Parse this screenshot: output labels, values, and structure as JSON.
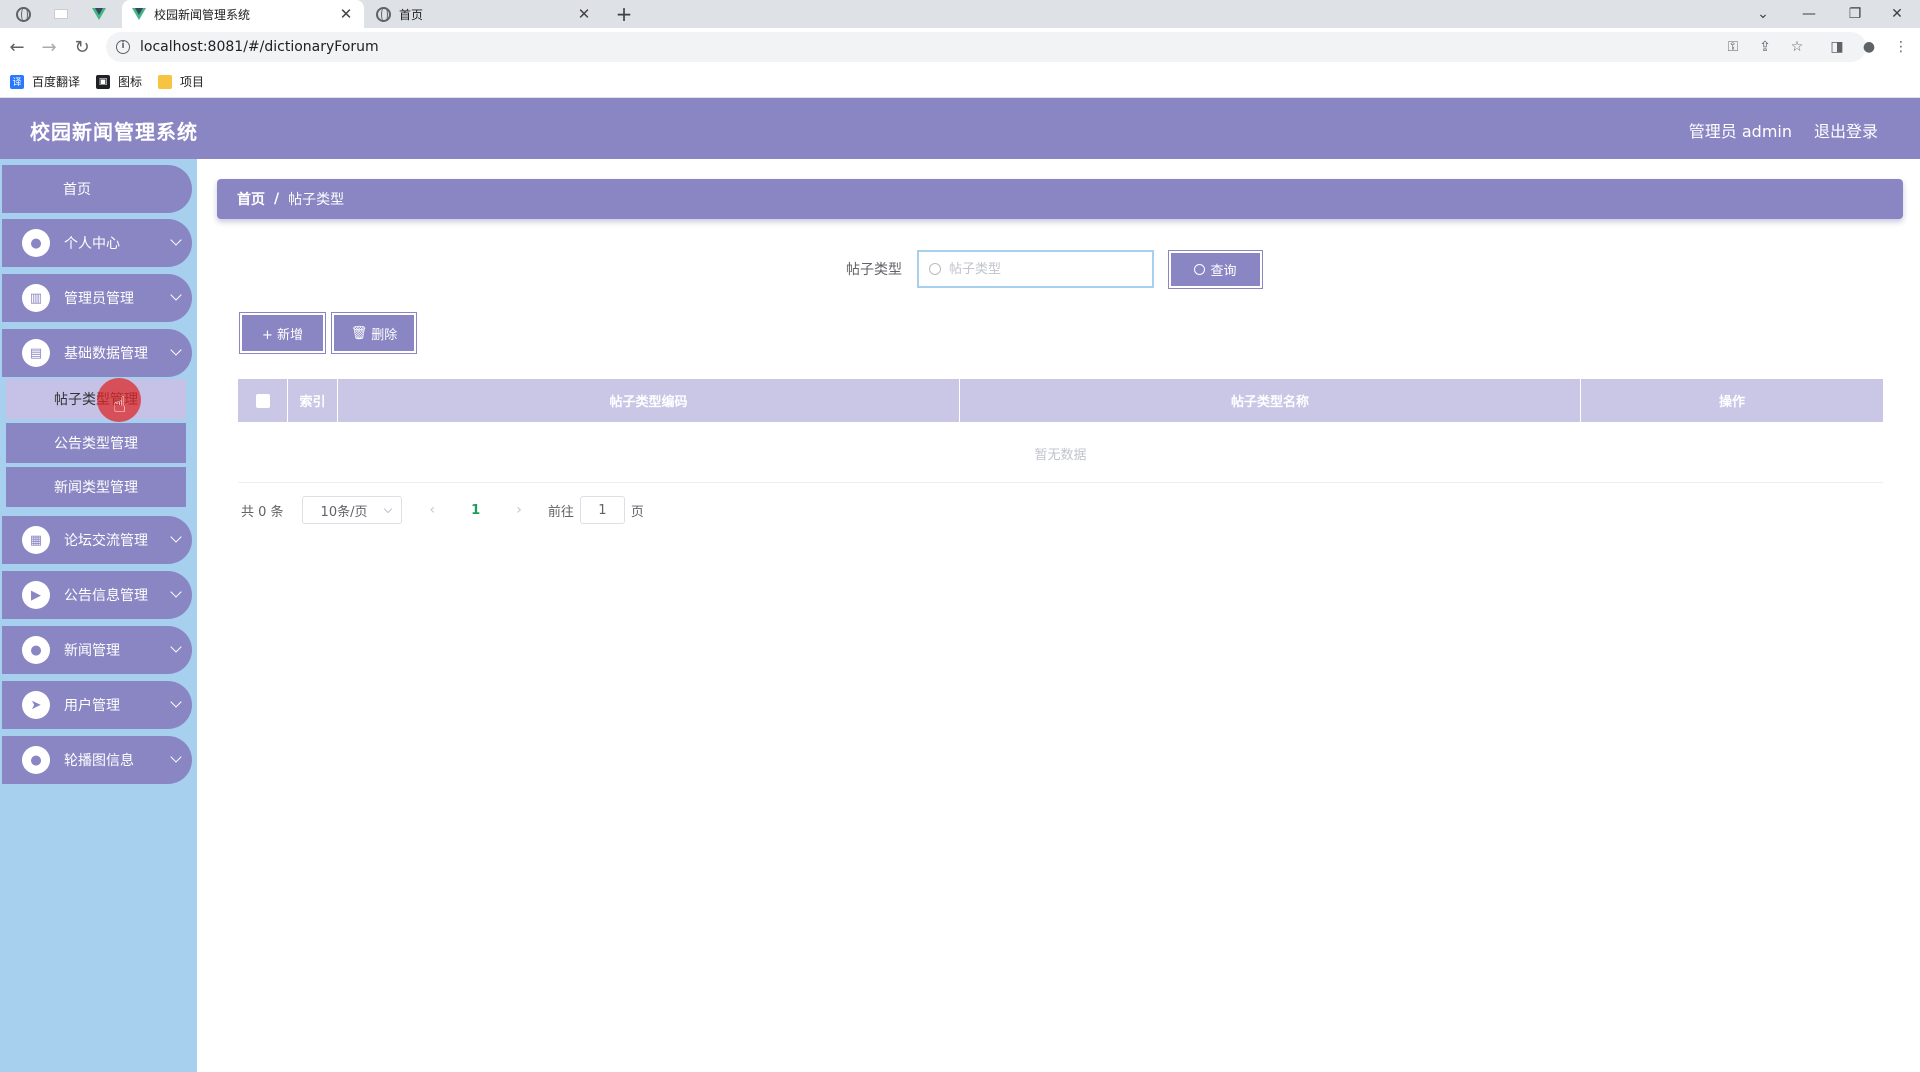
{
  "browser": {
    "tabs": [
      {
        "title": "校园新闻管理系统",
        "active": true
      },
      {
        "title": "首页",
        "active": false
      }
    ],
    "new_tab": "+",
    "url": "localhost:8081/#/dictionaryForum",
    "bookmarks": [
      {
        "label": "百度翻译",
        "icon": "translate-icon",
        "color": "#2979ff"
      },
      {
        "label": "图标",
        "icon": "image-icon",
        "color": "#202124"
      },
      {
        "label": "项目",
        "icon": "folder-icon",
        "color": "#f6c343"
      }
    ]
  },
  "header": {
    "title": "校园新闻管理系统",
    "user": "管理员 admin",
    "logout": "退出登录"
  },
  "sidebar": {
    "home": "首页",
    "items": [
      {
        "label": "个人中心",
        "icon": "user-icon"
      },
      {
        "label": "管理员管理",
        "icon": "book-icon"
      },
      {
        "label": "基础数据管理",
        "icon": "clipboard-icon"
      },
      {
        "label": "论坛交流管理",
        "icon": "grid-icon"
      },
      {
        "label": "公告信息管理",
        "icon": "video-icon"
      },
      {
        "label": "新闻管理",
        "icon": "location-icon"
      },
      {
        "label": "用户管理",
        "icon": "send-icon"
      },
      {
        "label": "轮播图信息",
        "icon": "user-icon"
      }
    ],
    "submenu": [
      {
        "label": "帖子类型管理",
        "active": true
      },
      {
        "label": "公告类型管理",
        "active": false
      },
      {
        "label": "新闻类型管理",
        "active": false
      }
    ]
  },
  "breadcrumb": {
    "home": "首页",
    "sep": "/",
    "current": "帖子类型"
  },
  "search": {
    "label": "帖子类型",
    "placeholder": "帖子类型",
    "button": "查询"
  },
  "actions": {
    "add": "+ 新增",
    "delete": "删除"
  },
  "table": {
    "columns": [
      "索引",
      "帖子类型编码",
      "帖子类型名称",
      "操作"
    ],
    "empty": "暂无数据"
  },
  "pagination": {
    "total": "共 0 条",
    "page_size": "10条/页",
    "current_page": "1",
    "goto_label": "前往",
    "goto_value": "1",
    "page_suffix": "页"
  },
  "colors": {
    "primary": "#8a86c3",
    "sidebar_bg": "#a6d0ee",
    "table_header": "#c9c6e6"
  }
}
